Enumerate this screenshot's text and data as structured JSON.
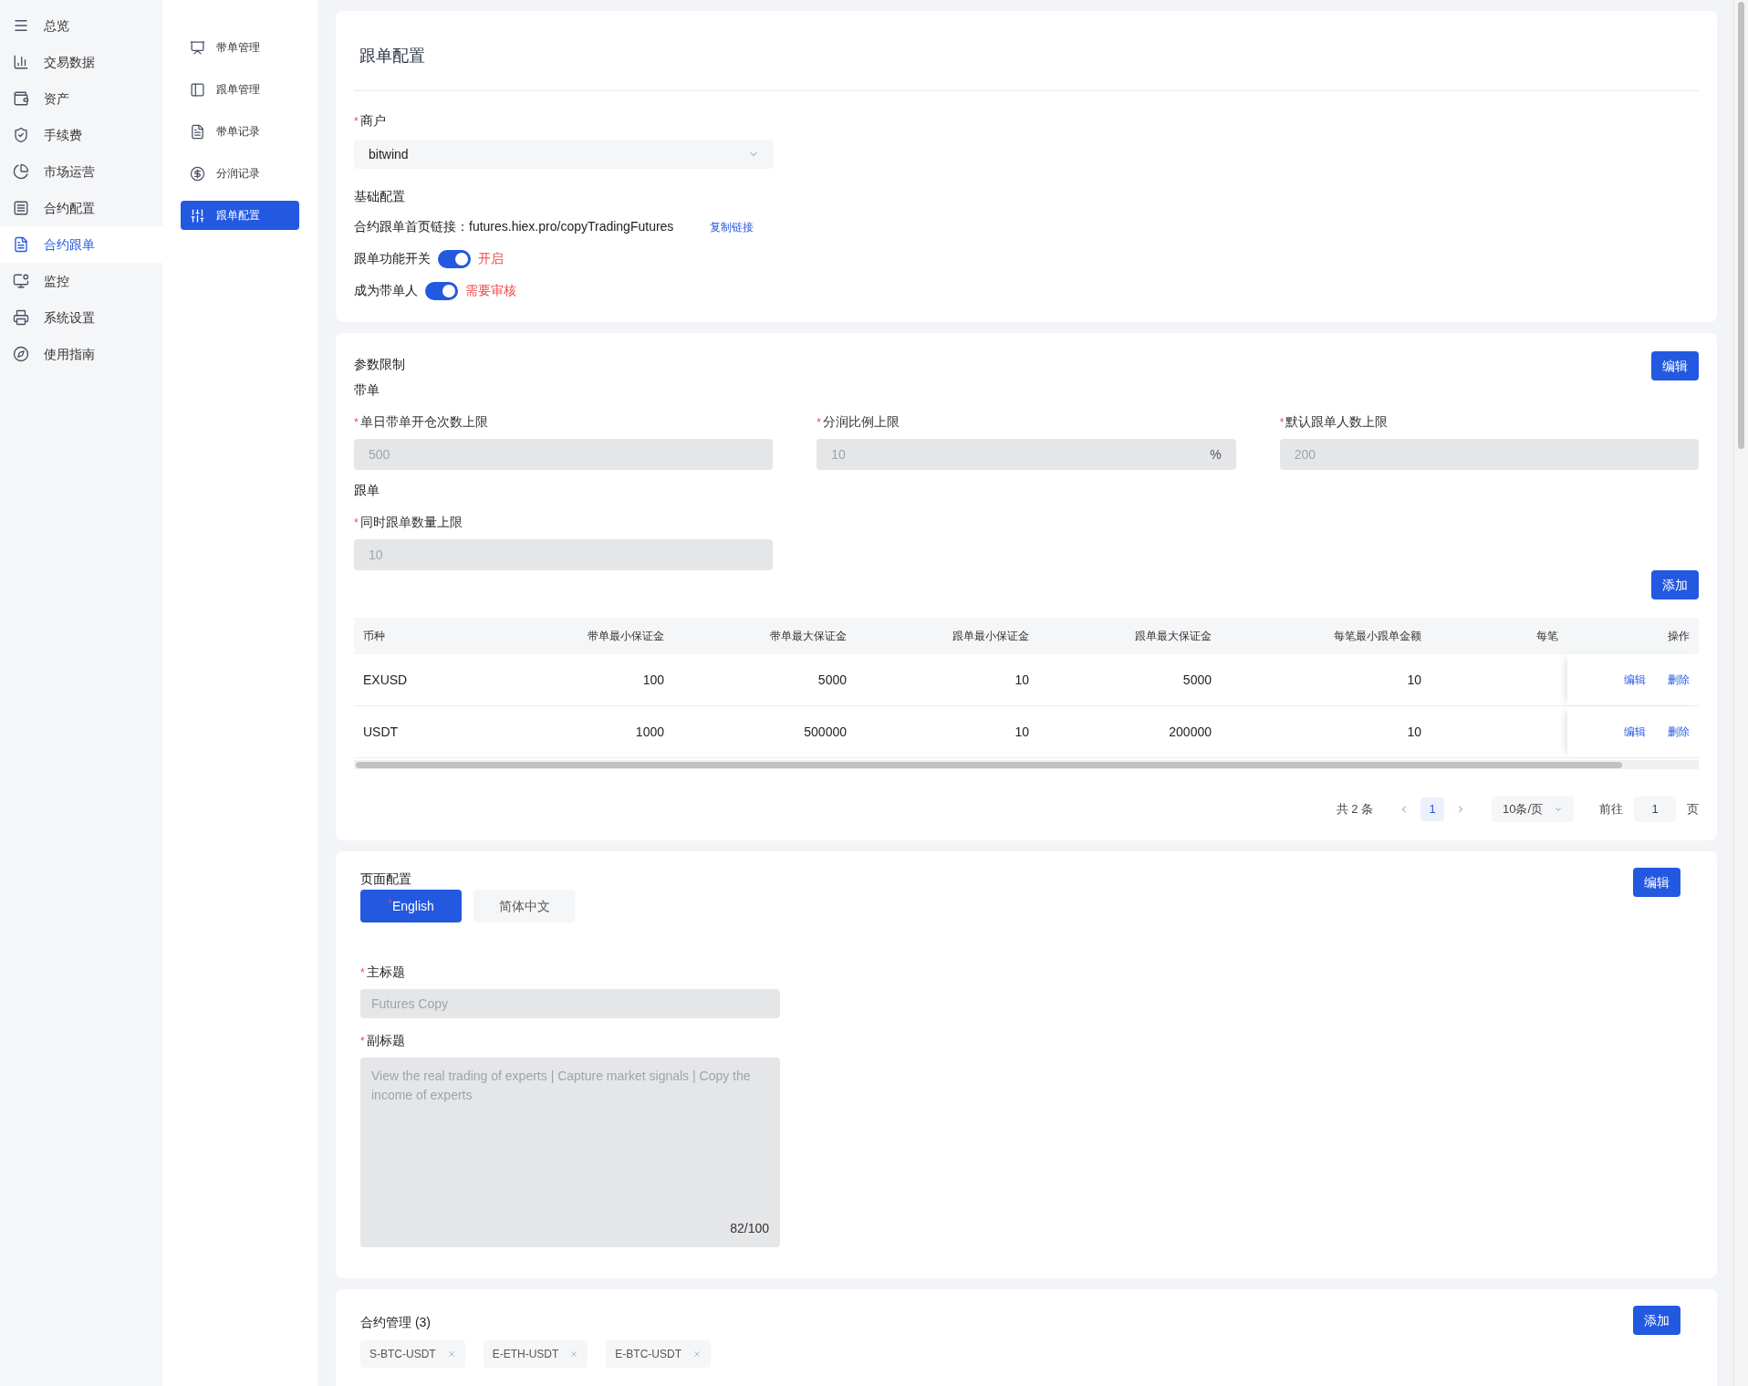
{
  "sidebar": {
    "items": [
      {
        "label": "总览",
        "selected": false
      },
      {
        "label": "交易数据",
        "selected": false
      },
      {
        "label": "资产",
        "selected": false
      },
      {
        "label": "手续费",
        "selected": false
      },
      {
        "label": "市场运营",
        "selected": false
      },
      {
        "label": "合约配置",
        "selected": false
      },
      {
        "label": "合约跟单",
        "selected": true
      },
      {
        "label": "监控",
        "selected": false
      },
      {
        "label": "系统设置",
        "selected": false
      },
      {
        "label": "使用指南",
        "selected": false
      }
    ]
  },
  "submenu": {
    "items": [
      {
        "label": "带单管理",
        "selected": false
      },
      {
        "label": "跟单管理",
        "selected": false
      },
      {
        "label": "带单记录",
        "selected": false
      },
      {
        "label": "分润记录",
        "selected": false
      },
      {
        "label": "跟单配置",
        "selected": true
      }
    ]
  },
  "page_title": "跟单配置",
  "merchant": {
    "label": "商户",
    "required_mark": "*",
    "value": "bitwind"
  },
  "basic": {
    "heading": "基础配置",
    "link_label": "合约跟单首页链接：",
    "link_value": "futures.hiex.pro/copyTradingFutures",
    "copy_link": "复制链接",
    "switches": [
      {
        "label": "跟单功能开关",
        "on": true,
        "status": "开启"
      },
      {
        "label": "成为带单人",
        "on": true,
        "status": "需要审核"
      }
    ]
  },
  "params": {
    "heading": "参数限制",
    "edit_button": "编辑",
    "groups": [
      {
        "title": "带单",
        "fields": [
          {
            "label": "单日带单开仓次数上限",
            "required_mark": "*",
            "value": "500"
          },
          {
            "label": "分润比例上限",
            "required_mark": "*",
            "value": "10",
            "suffix": "%"
          },
          {
            "label": "默认跟单人数上限",
            "required_mark": "*",
            "value": "200"
          }
        ]
      },
      {
        "title": "跟单",
        "fields": [
          {
            "label": "同时跟单数量上限",
            "required_mark": "*",
            "value": "10"
          }
        ]
      }
    ],
    "add_button": "添加",
    "table": {
      "columns": [
        "币种",
        "带单最小保证金",
        "带单最大保证金",
        "跟单最小保证金",
        "跟单最大保证金",
        "每笔最小跟单金额",
        "每笔",
        "操作"
      ],
      "rows": [
        {
          "cells": [
            "EXUSD",
            "100",
            "5000",
            "10",
            "5000",
            "10"
          ],
          "actions": [
            "编辑",
            "删除"
          ]
        },
        {
          "cells": [
            "USDT",
            "1000",
            "500000",
            "10",
            "200000",
            "10"
          ],
          "actions": [
            "编辑",
            "删除"
          ]
        }
      ]
    },
    "pagination": {
      "total": "共 2 条",
      "pages": [
        {
          "label": "1",
          "selected": true
        }
      ],
      "page_size": "10条/页",
      "goto_label": "前往",
      "goto_value": "1",
      "page_unit": "页"
    }
  },
  "page_config": {
    "heading": "页面配置",
    "edit_button": "编辑",
    "tabs": [
      {
        "label": "English",
        "required_mark": "*",
        "selected": true
      },
      {
        "label": "简体中文",
        "selected": false
      }
    ],
    "fields": [
      {
        "kind": "input",
        "label": "主标题",
        "required_mark": "*",
        "value": "Futures Copy"
      },
      {
        "kind": "textarea",
        "label": "副标题",
        "required_mark": "*",
        "value": "View the real trading of experts | Capture market signals | Copy the income of experts",
        "counter": "82/100"
      }
    ]
  },
  "contracts": {
    "heading": "合约管理 (3)",
    "add_button": "添加",
    "tags": [
      "S-BTC-USDT",
      "E-ETH-USDT",
      "E-BTC-USDT"
    ]
  }
}
